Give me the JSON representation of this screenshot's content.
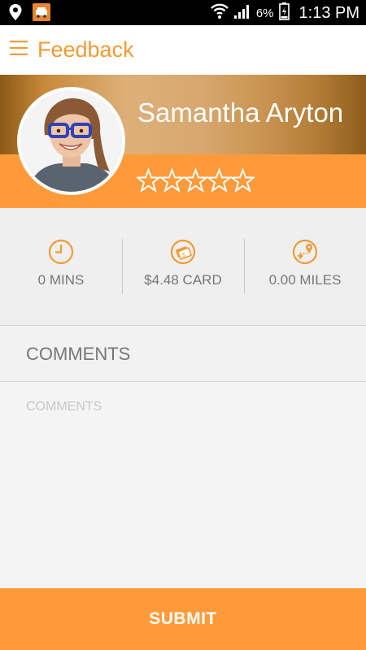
{
  "status_bar": {
    "battery_percent": "6%",
    "time": "1:13 PM",
    "icons": [
      "location-pin-icon",
      "taxi-app-icon",
      "wifi-icon",
      "signal-icon",
      "battery-icon"
    ]
  },
  "app_bar": {
    "title": "Feedback",
    "menu_icon": "hamburger-menu-icon"
  },
  "profile": {
    "name": "Samantha Aryton",
    "rating": 0,
    "max_rating": 5
  },
  "stats": [
    {
      "icon": "clock-icon",
      "label": "0 MINS"
    },
    {
      "icon": "card-payment-icon",
      "label": "$4.48 CARD"
    },
    {
      "icon": "route-icon",
      "label": "0.00 MILES"
    }
  ],
  "comments": {
    "header": "COMMENTS",
    "placeholder": "COMMENTS",
    "value": ""
  },
  "submit": {
    "label": "SUBMIT"
  },
  "colors": {
    "accent": "#ff9a3a",
    "title_orange": "#f39a35",
    "text_gray": "#777777"
  }
}
